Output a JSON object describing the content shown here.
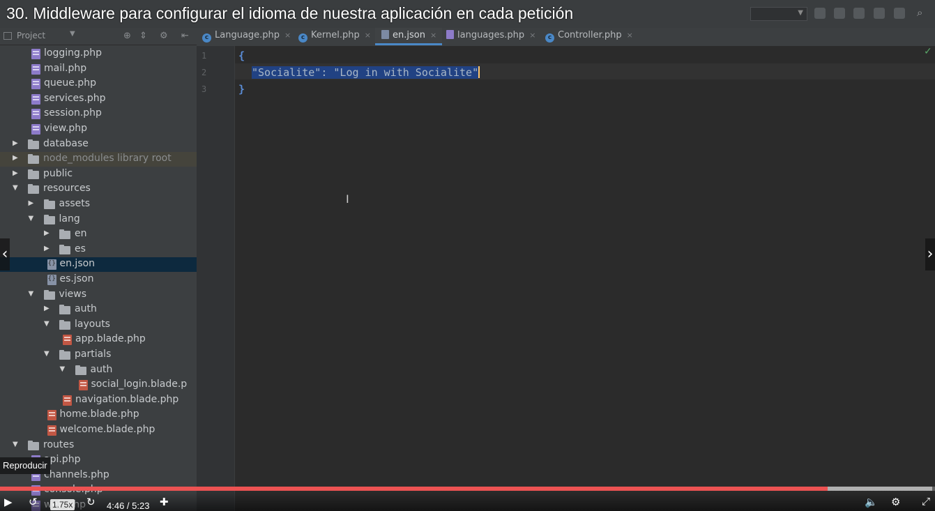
{
  "video": {
    "title": "30. Middleware para configurar el idioma de nuestra aplicación en cada petición",
    "tooltip": "Reproducir",
    "speed": "1.75x",
    "time": "4:46 / 5:23",
    "progress": 0.885,
    "buffered": 0.997
  },
  "ide": {
    "project_label": "Project",
    "tabs": [
      {
        "label": "Language.php",
        "icon": "class-icon",
        "active": false
      },
      {
        "label": "Kernel.php",
        "icon": "class-icon",
        "active": false
      },
      {
        "label": "en.json",
        "icon": "json-icon",
        "active": true
      },
      {
        "label": "languages.php",
        "icon": "php-icon",
        "active": false
      },
      {
        "label": "Controller.php",
        "icon": "class-icon",
        "active": false
      }
    ],
    "tree": [
      {
        "label": "logging.php",
        "type": "php",
        "depth": 3
      },
      {
        "label": "mail.php",
        "type": "php",
        "depth": 3
      },
      {
        "label": "queue.php",
        "type": "php",
        "depth": 3
      },
      {
        "label": "services.php",
        "type": "php",
        "depth": 3
      },
      {
        "label": "session.php",
        "type": "php",
        "depth": 3
      },
      {
        "label": "view.php",
        "type": "php",
        "depth": 3
      },
      {
        "label": "database",
        "type": "folder",
        "depth": 1,
        "expanded": false
      },
      {
        "label": "node_modules  library root",
        "type": "folder",
        "depth": 1,
        "expanded": false,
        "library": true
      },
      {
        "label": "public",
        "type": "folder",
        "depth": 1,
        "expanded": false
      },
      {
        "label": "resources",
        "type": "folder",
        "depth": 1,
        "expanded": true
      },
      {
        "label": "assets",
        "type": "folder",
        "depth": 2,
        "expanded": false
      },
      {
        "label": "lang",
        "type": "folder",
        "depth": 2,
        "expanded": true
      },
      {
        "label": "en",
        "type": "folder",
        "depth": 3,
        "expanded": false
      },
      {
        "label": "es",
        "type": "folder",
        "depth": 3,
        "expanded": false
      },
      {
        "label": "en.json",
        "type": "json",
        "depth": 4,
        "selected": true
      },
      {
        "label": "es.json",
        "type": "json",
        "depth": 4
      },
      {
        "label": "views",
        "type": "folder",
        "depth": 2,
        "expanded": true
      },
      {
        "label": "auth",
        "type": "folder",
        "depth": 3,
        "expanded": false
      },
      {
        "label": "layouts",
        "type": "folder",
        "depth": 3,
        "expanded": true
      },
      {
        "label": "app.blade.php",
        "type": "blade",
        "depth": 5
      },
      {
        "label": "partials",
        "type": "folder",
        "depth": 3,
        "expanded": true
      },
      {
        "label": "auth",
        "type": "folder",
        "depth": 4,
        "expanded": true
      },
      {
        "label": "social_login.blade.p",
        "type": "blade",
        "depth": 6
      },
      {
        "label": "navigation.blade.php",
        "type": "blade",
        "depth": 5
      },
      {
        "label": "home.blade.php",
        "type": "blade",
        "depth": 4
      },
      {
        "label": "welcome.blade.php",
        "type": "blade",
        "depth": 4
      },
      {
        "label": "routes",
        "type": "folder",
        "depth": 1,
        "expanded": true
      },
      {
        "label": "api.php",
        "type": "php",
        "depth": 3
      },
      {
        "label": "channels.php",
        "type": "php",
        "depth": 3
      },
      {
        "label": "console.php",
        "type": "php",
        "depth": 3
      },
      {
        "label": "web.php",
        "type": "php",
        "depth": 3
      }
    ],
    "editor": {
      "line_numbers": [
        "1",
        "2",
        "3"
      ],
      "line1": "{",
      "line2": "\"Socialite\": \"Log in with Socialite\"",
      "line3": "}"
    }
  }
}
